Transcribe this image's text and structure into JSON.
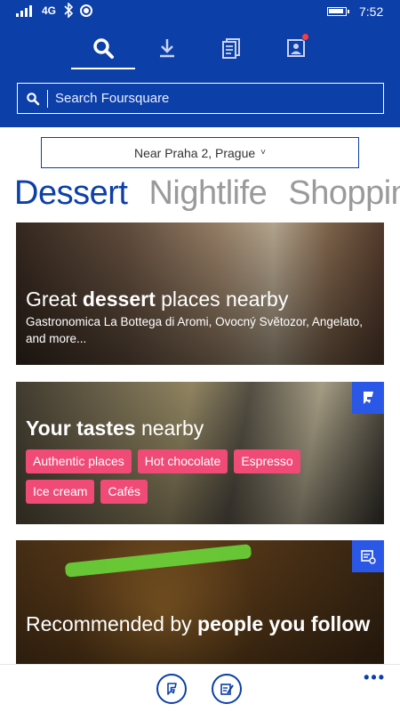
{
  "statusbar": {
    "network": "4G",
    "time": "7:52"
  },
  "tabs": [
    {
      "icon": "search-icon",
      "active": true
    },
    {
      "icon": "download-icon",
      "active": false
    },
    {
      "icon": "lists-icon",
      "active": false
    },
    {
      "icon": "profile-icon",
      "active": false,
      "notification": true
    }
  ],
  "search": {
    "placeholder": "Search Foursquare",
    "value": ""
  },
  "location": {
    "label": "Near Praha 2, Prague",
    "chevron": "˅"
  },
  "categories": [
    "Dessert",
    "Nightlife",
    "Shopping"
  ],
  "cards": {
    "dessert": {
      "title_prefix": "Great ",
      "title_bold": "dessert",
      "title_suffix": " places nearby",
      "subtitle": "Gastronomica La Bottega di Aromi, Ovocný Světozor, Angelato, and more..."
    },
    "tastes": {
      "title_bold": "Your tastes",
      "title_suffix": " nearby",
      "tags": [
        "Authentic places",
        "Hot chocolate",
        "Espresso",
        "Ice cream",
        "Cafés"
      ]
    },
    "recommended": {
      "title_prefix": "Recommended by ",
      "title_bold": "people you follow"
    }
  },
  "appbar": {
    "more": "•••"
  },
  "colors": {
    "brand": "#0c3fa8",
    "tag": "#f04a77",
    "badge": "#2b57e6"
  }
}
